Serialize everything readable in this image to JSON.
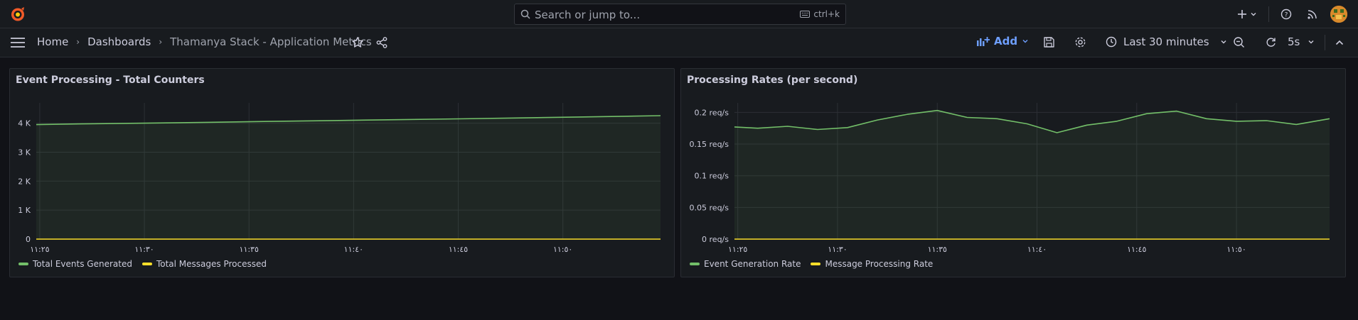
{
  "topbar": {
    "search_placeholder": "Search or jump to...",
    "search_shortcut": "ctrl+k",
    "icons": [
      "grafana-logo",
      "search-icon",
      "keyboard-icon",
      "plus-icon",
      "chevron-down-icon",
      "help-icon",
      "news-icon",
      "avatar"
    ]
  },
  "breadcrumb": {
    "home": "Home",
    "dashboards": "Dashboards",
    "current": "Thamanya Stack - Application Metrics"
  },
  "toolbar": {
    "add_label": "Add",
    "time_range": "Last 30 minutes",
    "refresh_interval": "5s"
  },
  "colors": {
    "green": "#73bf69",
    "yellow": "#fade2a",
    "accent": "#6e9fff",
    "background": "#111217",
    "panel": "#181b1f"
  },
  "panels": [
    {
      "title": "Event Processing - Total Counters",
      "legend": [
        "Total Events Generated",
        "Total Messages Processed"
      ]
    },
    {
      "title": "Processing Rates (per second)",
      "legend": [
        "Event Generation Rate",
        "Message Processing Rate"
      ]
    }
  ],
  "chart_data": [
    {
      "type": "line",
      "title": "Event Processing - Total Counters",
      "x_ticks": [
        "١١:٢٥",
        "١١:٣٠",
        "١١:٣٥",
        "١١:٤٠",
        "١١:٤٥",
        "١١:٥٠"
      ],
      "x_range": [
        "11:24:50",
        "11:54:40"
      ],
      "y_ticks": [
        "0",
        "1 K",
        "2 K",
        "3 K",
        "4 K"
      ],
      "ylim": [
        0,
        4700
      ],
      "grid": true,
      "legend_placement": "bottom-left",
      "series": [
        {
          "name": "Total Events Generated",
          "color": "#73bf69",
          "x": [
            "11:24:50",
            "11:27:00",
            "11:30:00",
            "11:33:00",
            "11:36:00",
            "11:39:00",
            "11:42:00",
            "11:45:00",
            "11:48:00",
            "11:51:00",
            "11:54:40"
          ],
          "values": [
            3950,
            3975,
            4000,
            4030,
            4060,
            4090,
            4120,
            4150,
            4180,
            4215,
            4260
          ]
        },
        {
          "name": "Total Messages Processed",
          "color": "#fade2a",
          "x": [
            "11:24:50",
            "11:54:40"
          ],
          "values": [
            0,
            0
          ]
        }
      ]
    },
    {
      "type": "line",
      "title": "Processing Rates (per second)",
      "x_ticks": [
        "١١:٢٥",
        "١١:٣٠",
        "١١:٣٥",
        "١١:٤٠",
        "١١:٤٥",
        "١١:٥٠"
      ],
      "x_range": [
        "11:24:50",
        "11:54:40"
      ],
      "y_ticks": [
        "0 req/s",
        "0.05 req/s",
        "0.1 req/s",
        "0.15 req/s",
        "0.2 req/s"
      ],
      "ylim": [
        0,
        0.215
      ],
      "grid": true,
      "legend_placement": "bottom-left",
      "series": [
        {
          "name": "Event Generation Rate",
          "color": "#73bf69",
          "x": [
            "11:24:50",
            "11:26:00",
            "11:27:30",
            "11:29:00",
            "11:30:30",
            "11:32:00",
            "11:33:30",
            "11:35:00",
            "11:36:30",
            "11:38:00",
            "11:39:30",
            "11:41:00",
            "11:42:30",
            "11:44:00",
            "11:45:30",
            "11:47:00",
            "11:48:30",
            "11:50:00",
            "11:51:30",
            "11:53:00",
            "11:54:40"
          ],
          "values": [
            0.177,
            0.175,
            0.178,
            0.173,
            0.176,
            0.188,
            0.197,
            0.203,
            0.192,
            0.19,
            0.182,
            0.168,
            0.18,
            0.186,
            0.198,
            0.202,
            0.19,
            0.186,
            0.187,
            0.181,
            0.19
          ]
        },
        {
          "name": "Message Processing Rate",
          "color": "#fade2a",
          "x": [
            "11:24:50",
            "11:54:40"
          ],
          "values": [
            0,
            0
          ]
        }
      ]
    }
  ]
}
